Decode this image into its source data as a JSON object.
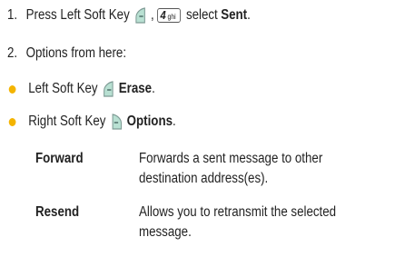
{
  "colors": {
    "text": "#222222",
    "bullet": "#f4b400",
    "softkey_fill": "#b8e0d2",
    "softkey_stroke": "#7d9a94"
  },
  "step1": {
    "number": "1.",
    "prefix": "Press Left Soft Key",
    "comma": ",",
    "key_digit": "4",
    "key_letters": "ghi",
    "select_text": "select",
    "select_target": "Sent",
    "end": "."
  },
  "step2": {
    "number": "2.",
    "text": "Options from here:"
  },
  "bullets": [
    {
      "prefix": "Left Soft Key",
      "icon": "left-softkey-icon",
      "action": "Erase",
      "end": "."
    },
    {
      "prefix": "Right Soft Key",
      "icon": "right-softkey-icon",
      "action": "Options",
      "end": "."
    }
  ],
  "options": [
    {
      "term": "Forward",
      "desc_lines": [
        "Forwards a sent message to other",
        "destination address(es)."
      ]
    },
    {
      "term": "Resend",
      "desc_lines": [
        "Allows you to retransmit the selected",
        "message."
      ]
    }
  ]
}
